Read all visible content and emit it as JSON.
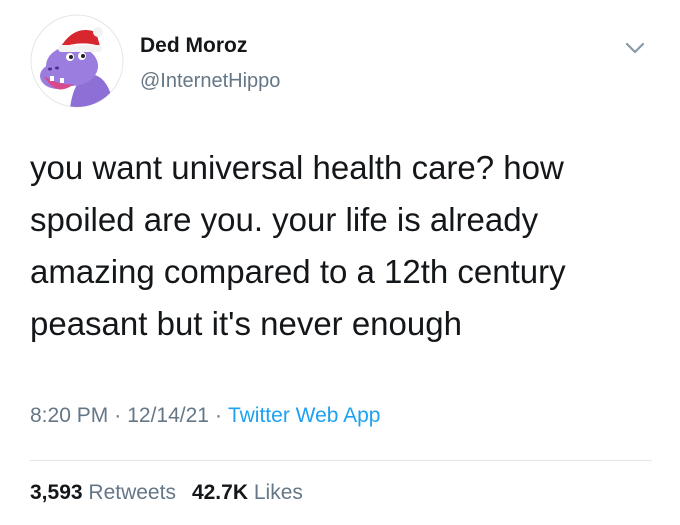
{
  "user": {
    "display_name": "Ded Moroz",
    "handle": "@InternetHippo",
    "avatar_icon": "purple-hippo-santa-hat-avatar"
  },
  "tweet": {
    "text": "you want universal health care? how spoiled are you. your life is already amazing compared to a 12th century peasant but it's never enough",
    "time": "8:20 PM",
    "date": "12/14/21",
    "source": "Twitter Web App",
    "separator": "·"
  },
  "stats": {
    "retweets_count": "3,593",
    "retweets_label": "Retweets",
    "likes_count": "42.7K",
    "likes_label": "Likes"
  },
  "colors": {
    "text": "#14171a",
    "secondary": "#657786",
    "link": "#1da1f2",
    "divider": "#e1e8ed",
    "avatar_bg": "#8e6fd6"
  }
}
